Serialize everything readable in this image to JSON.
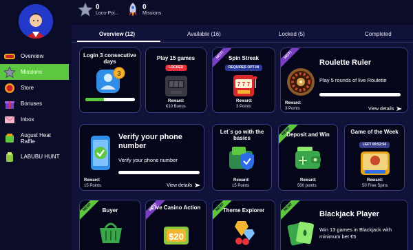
{
  "header": {
    "points_value": "0",
    "points_label": "Loco-Poi...",
    "missions_value": "0",
    "missions_label": "Missions"
  },
  "sidebar": {
    "items": [
      {
        "label": "Overview",
        "icon": "flame-badge-icon"
      },
      {
        "label": "Missions",
        "icon": "star-icon",
        "active": true
      },
      {
        "label": "Store",
        "icon": "coin-icon"
      },
      {
        "label": "Bonuses",
        "icon": "gift-icon"
      },
      {
        "label": "Inbox",
        "icon": "envelope-icon"
      },
      {
        "label": "August Heat Raffle",
        "icon": "raffle-icon"
      },
      {
        "label": "LABUBU HUNT",
        "icon": "labubu-icon"
      }
    ]
  },
  "tabs": [
    {
      "label": "Overview (12)",
      "active": true
    },
    {
      "label": "Available (16)"
    },
    {
      "label": "Locked (5)"
    },
    {
      "label": "Completed"
    }
  ],
  "cards": {
    "login": {
      "title": "Login 3 consecutive days",
      "badge_count": "3",
      "progress": 0.38
    },
    "games15": {
      "title": "Play 15 games",
      "status": "LOCKED",
      "reward_label": "Reward:",
      "reward_value": "€10 Bonus"
    },
    "spin": {
      "ribbon": "HOT!",
      "title": "Spin Streak",
      "status": "REQUIRES OPT-IN",
      "reward_label": "Reward:",
      "reward_value": "3 Points"
    },
    "roulette": {
      "ribbon": "HOT!",
      "title": "Roulette Ruler",
      "description": "Play 5 rounds of live Roulette",
      "reward_label": "Reward:",
      "reward_value": "3 Points",
      "view": "View details",
      "progress": 0.0
    },
    "verify": {
      "title": "Verify your phone number",
      "description": "Verify your phone number",
      "reward_label": "Reward:",
      "reward_value": "15 Points",
      "view": "View details",
      "progress": 0.0
    },
    "basics": {
      "title": "Let`s go with the basics",
      "reward_label": "Reward:",
      "reward_value": "15 Points"
    },
    "deposit": {
      "ribbon": "NEW!",
      "title": "Deposit and Win",
      "reward_label": "Reward:",
      "reward_value": "500 points"
    },
    "gotw": {
      "title": "Game of the Week",
      "timer": "LEFT 09:52:54",
      "reward_label": "Reward:",
      "reward_value": "50 Free Spins"
    },
    "buyer": {
      "ribbon": "NEW!",
      "title": "Buyer"
    },
    "livecasino": {
      "ribbon": "HOT!",
      "title": "Live Casino Action",
      "amount": "$20"
    },
    "theme": {
      "ribbon": "NEW!",
      "title": "Theme Explorer"
    },
    "blackjack": {
      "ribbon": "NEW!",
      "title": "Blackjack Player",
      "description": "Win 13 games in Blackjack with minimum bet €5"
    }
  },
  "colors": {
    "accent": "#5cc73f",
    "hot": "#7b3fc4",
    "locked": "#e5323b",
    "bg": "#10123a"
  }
}
